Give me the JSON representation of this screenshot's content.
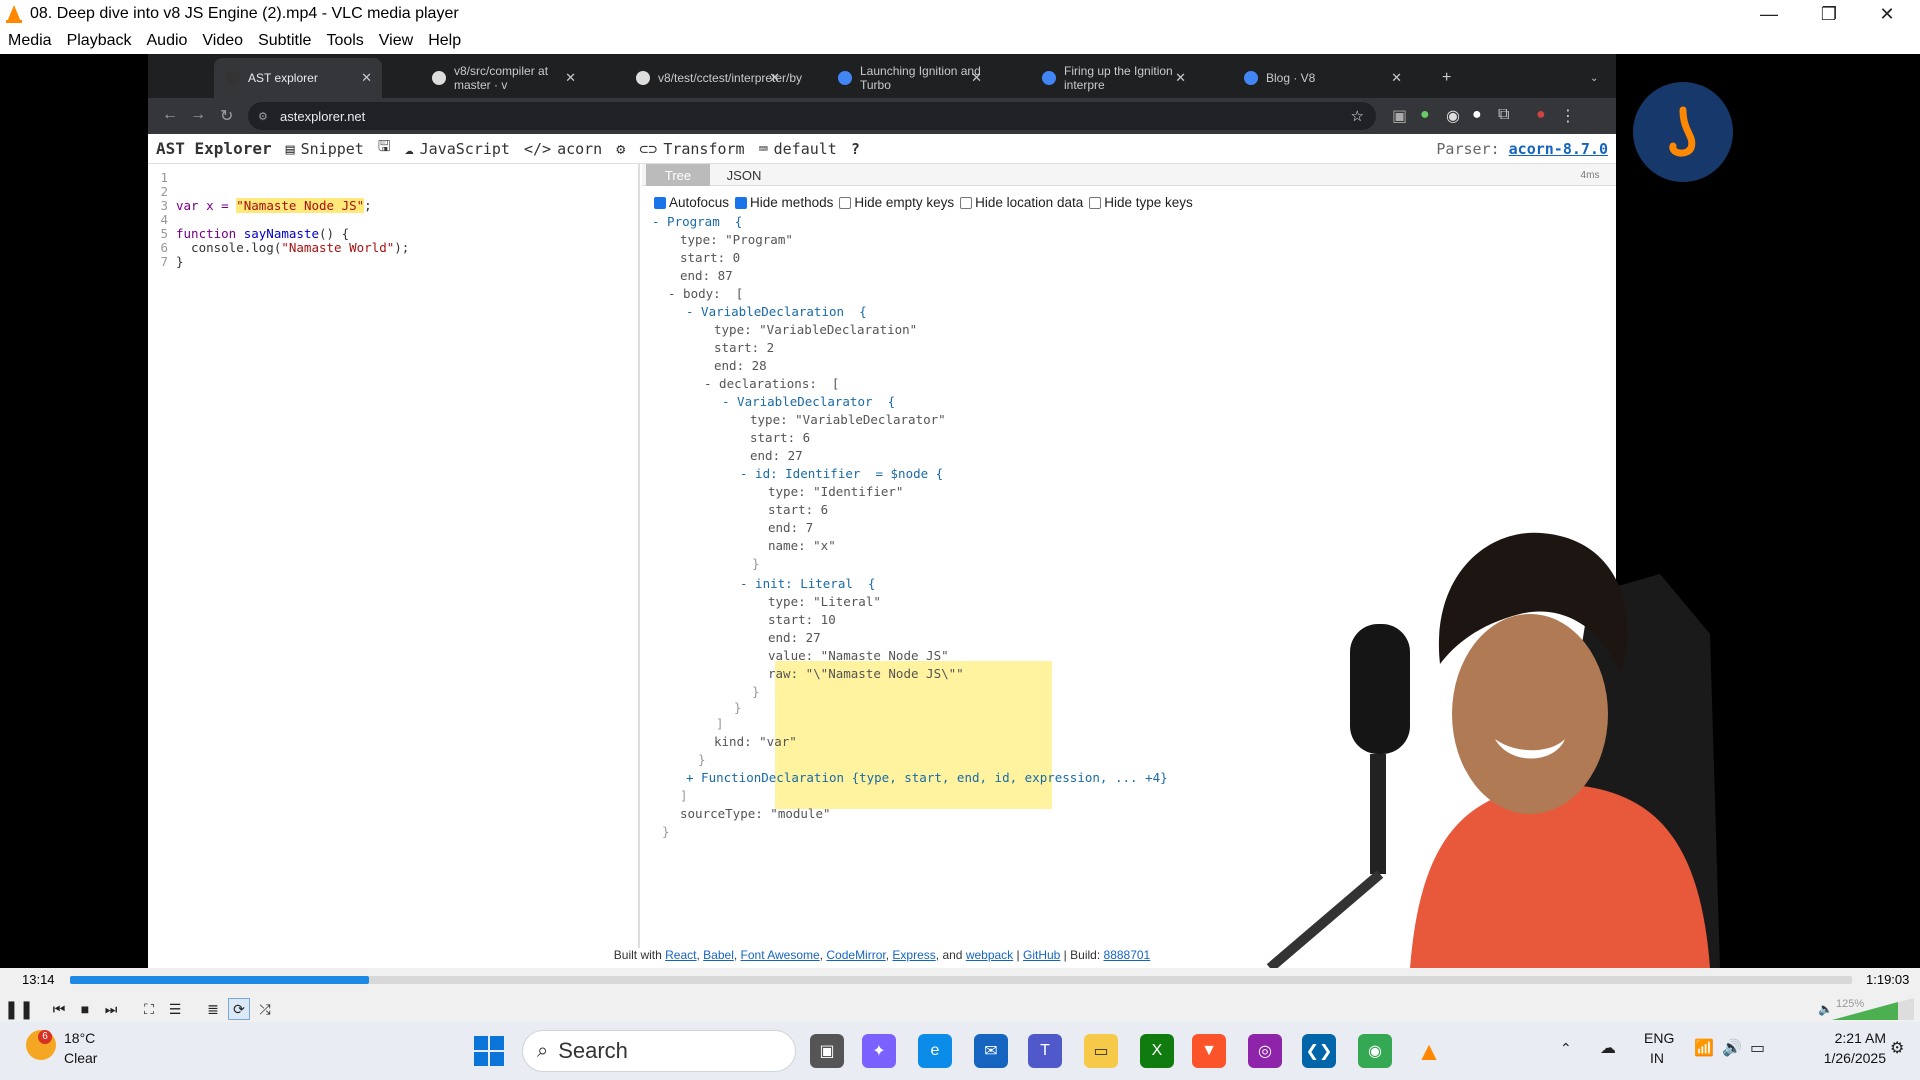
{
  "window": {
    "title": "08. Deep dive into v8 JS Engine (2).mp4 - VLC media player",
    "minimize_label": "—",
    "maximize_label": "❐",
    "close_label": "✕"
  },
  "menu": [
    "Media",
    "Playback",
    "Audio",
    "Video",
    "Subtitle",
    "Tools",
    "View",
    "Help"
  ],
  "browser": {
    "tabs": [
      "AST explorer",
      "v8/src/compiler at master · v",
      "v8/test/cctest/interpreter/by",
      "Launching Ignition and Turbo",
      "Firing up the Ignition interpre",
      "Blog · V8"
    ],
    "new_tab": "+",
    "url": "astexplorer.net"
  },
  "ast": {
    "brand": "AST Explorer",
    "snippet": "Snippet",
    "language": "JavaScript",
    "parser_name": "acorn",
    "transform": "Transform",
    "default": "default",
    "help": "?",
    "parser_label": "Parser:",
    "parser_version": "acorn-8.7.0",
    "time": "4ms",
    "tab_tree": "Tree",
    "tab_json": "JSON",
    "options": [
      {
        "label": "Autofocus",
        "checked": true
      },
      {
        "label": "Hide methods",
        "checked": true
      },
      {
        "label": "Hide empty keys",
        "checked": false
      },
      {
        "label": "Hide location data",
        "checked": false
      },
      {
        "label": "Hide type keys",
        "checked": false
      }
    ],
    "code_line_numbers": [
      "1",
      "2",
      "3",
      "4",
      "5",
      "6",
      "7"
    ],
    "code": {
      "l3_a": "var x = ",
      "l3_str": "\"Namaste Node JS\"",
      "l3_end": ";",
      "l5_kw": "function ",
      "l5_fn": "sayNamaste",
      "l5_end": "() {",
      "l6_a": "  console.log(",
      "l6_str": "\"Namaste World\"",
      "l6_end": ");",
      "l7": "}"
    },
    "tree": {
      "program": "- Program  {",
      "p_type": "type: \"Program\"",
      "p_start": "start: 0",
      "p_end": "end: 87",
      "body": "- body:  [",
      "vd": "- VariableDeclaration  {",
      "vd_type": "type: \"VariableDeclaration\"",
      "vd_start": "start: 2",
      "vd_end": "end: 28",
      "decls": "- declarations:  [",
      "vdr": "- VariableDeclarator  {",
      "vdr_type": "type: \"VariableDeclarator\"",
      "vdr_start": "start: 6",
      "vdr_end": "end: 27",
      "id": "- id: Identifier  = $node {",
      "id_type": "type: \"Identifier\"",
      "id_start": "start: 6",
      "id_end": "end: 7",
      "id_name": "name: \"x\"",
      "close1": "}",
      "init": "- init: Literal  {",
      "lit_type": "type: \"Literal\"",
      "lit_start": "start: 10",
      "lit_end": "end: 27",
      "lit_value": "value: \"Namaste Node JS\"",
      "lit_raw": "raw: \"\\\"Namaste Node JS\\\"\"",
      "close2": "}",
      "close3": "}",
      "close4": "]",
      "kind": "kind: \"var\"",
      "close5": "}",
      "fd": "+ FunctionDeclaration {type, start, end, id, expression, ... +4}",
      "close6": "]",
      "source_type": "sourceType: \"module\"",
      "close7": "}"
    },
    "footer": {
      "built": "Built with",
      "react": "React",
      "babel": "Babel",
      "fa": "Font Awesome",
      "cm": "CodeMirror",
      "express": "Express",
      "and": "and",
      "webpack": "webpack",
      "github": "GitHub",
      "build_label": "Build:",
      "build": "8888701"
    }
  },
  "player": {
    "elapsed": "13:14",
    "total": "1:19:03",
    "progress": 0.168,
    "volume": "125%"
  },
  "taskbar": {
    "weather_temp": "18°C",
    "weather_cond": "Clear",
    "weather_badge": "6",
    "search": "Search",
    "lang1": "ENG",
    "lang2": "IN",
    "time": "2:21 AM",
    "date": "1/26/2025"
  },
  "colors": {
    "accent": "#1a73e8",
    "progress": "#1e88e5",
    "highlight": "#fff3a0",
    "vlc": "#ff8800"
  }
}
